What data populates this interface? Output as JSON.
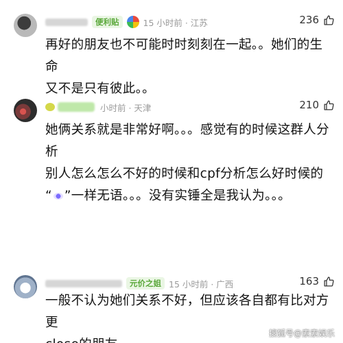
{
  "comments": [
    {
      "badge_label": "便利贴",
      "time": "15 小时前 · 江苏",
      "likes": "236",
      "text": "再好的朋友也不可能时时刻刻在一起。。她们的生命\n又不是只有彼此。。"
    },
    {
      "time": "小时前 · 天津",
      "likes": "210",
      "text_before_emoji": "她俩关系就是非常好啊。。。感觉有的时候这群人分析\n别人怎么怎么不好的时候和cpf分析怎么好时候的\n“",
      "text_after_emoji": "”一样无语。。。没有实锤全是我认为。。。"
    },
    {
      "badge_label": "元价之姐",
      "time": "15 小时前 · 广西",
      "likes": "163",
      "text": "一般不认为她们关系不好，但应该各自都有比对方更\nclose的朋友。。。。。"
    }
  ],
  "watermark": "搜狐号@素素娱乐",
  "colors": {
    "badge_text": "#5aa83a",
    "badge_bg": "#eaf6e4",
    "meta_gray": "#9a9a9a"
  },
  "icons": [
    "thumbs-up-icon",
    "app-logo-icon",
    "emoji-icon"
  ]
}
